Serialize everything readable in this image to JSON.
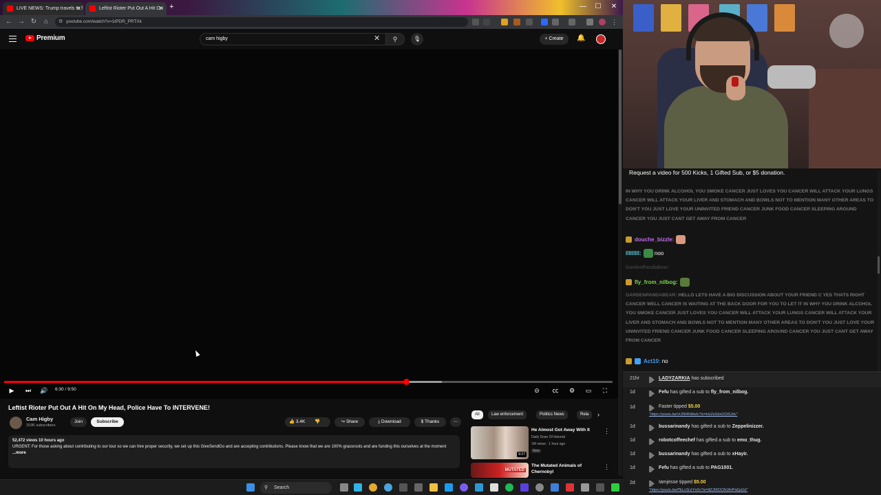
{
  "browser": {
    "tabs": [
      {
        "title": "LIVE NEWS: Trump travels to f",
        "active": false
      },
      {
        "title": "Leftist Rioter Put Out A Hit On",
        "active": true
      }
    ],
    "url": "youtube.com/watch?v=1tPDR_PRTXk",
    "window_controls": {
      "minimize": "—",
      "maximize": "☐",
      "close": "✕"
    }
  },
  "youtube": {
    "brand": "Premium",
    "search_value": "cam higby",
    "create_label": "Create",
    "player": {
      "time": "6:30 / 9:50",
      "progress": 0.661,
      "buffered": 0.72
    },
    "video": {
      "title": "Leftist Rioter Put Out A Hit On My Head, Police Have To INTERVENE!",
      "channel": "Cam Higby",
      "subscribers": "153K subscribers",
      "join_label": "Join",
      "subscribe_label": "Subscribe",
      "likes": "3.4K",
      "share_label": "Share",
      "download_label": "Download",
      "thanks_label": "Thanks",
      "more_label": "⋯"
    },
    "description": {
      "meta": "52,472 views  10 hours ago",
      "text": "URGENT: For those asking about contributing to our tour so we can hire proper security, we set up this GiveSendGo and are accepting contributions. Please know that we are 100% grassroots and are funding this ourselves at the moment",
      "more": "...more"
    },
    "chips": [
      "All",
      "Law enforcement",
      "Politics News",
      "Rela"
    ],
    "recommended": [
      {
        "title": "He Almost Got Away With It",
        "channel": "Daily Dose Of Internet",
        "views": "1M views · 1 hour ago",
        "badge": "New",
        "duration": "8:27"
      },
      {
        "title": "The Mutated Animals of",
        "title2": "Chernobyl",
        "label": "MUTATED"
      }
    ]
  },
  "taskbar": {
    "search_label": "Search"
  },
  "chat": {
    "banner": "Request a video for 500 Kicks, 1 Gifted Sub, or $5 donation.",
    "messages": [
      {
        "user": "",
        "text": "IN WHY YOU DRINK ALCOHOL YOU SMOKE CANCER JUST LOVES YOU CANCER WILL ATTACK YOUR LUNGS CANCER WILL ATTACK YOUR LIVER AND STOMACH AND BOWLS NOT TO MENTION MANY OTHER AREAS TO DON'T YOU JUST LOVE YOUR UNINVITED FRIEND CANCER JUNK FOOD CANCER SLEEPING AROUND CANCER YOU JUST CANT GET AWAY FROM CANCER"
      },
      {
        "user": "douche_bizzle:",
        "text": "",
        "color": "#c26bf0"
      },
      {
        "user": "lllllllll:",
        "text": "noo",
        "color": "#56c8d8"
      },
      {
        "user": "GardenPandaBear:",
        "text": "",
        "ghost": true
      },
      {
        "user": "fly_from_nilbog:",
        "text": "",
        "color": "#7dd64f"
      },
      {
        "user": "GardenPandaBear:",
        "text": "HELLO LETS HAVE A BIG DISCUSSION ABOUT YOUR FRIEND C YES THATS RIGHT CANCER WELL CANCER IS WAITING AT THE BACK DOOR FOR YOU TO LET IT IN WHY YOU DRINK ALCOHOL YOU SMOKE CANCER JUST LOVES YOU CANCER WILL ATTACK YOUR LUNGS CANCER WILL ATTACK YOUR LIVER AND STOMACH AND BOWLS NOT TO MENTION MANY OTHER AREAS TO DON'T YOU JUST LOVE YOUR UNINVITED FRIEND CANCER JUNK FOOD CANCER SLEEPING AROUND CANCER YOU JUST CANT GET AWAY FROM CANCER"
      },
      {
        "user": "Act10:",
        "text": "no",
        "color": "#3fa3f5"
      }
    ]
  },
  "alerts": [
    {
      "time": "21hr",
      "pre": "",
      "user": "LADYZARKIA",
      "text": " has subscribed"
    },
    {
      "time": "1d",
      "pre": "Fefu",
      "text": " has gifted a sub to ",
      "user": "fly_from_nilbog."
    },
    {
      "time": "1d",
      "pre": "Faster",
      "text": " tipped ",
      "amount": "$5.00",
      "link": "\"https://youtu.be/vU0lI4hMwtc?si=Hx2oSbxOOi5Jrlv\""
    },
    {
      "time": "1d",
      "pre": "bussarinandy",
      "text": " has gifted a sub to ",
      "user": "Zeppelinizzer."
    },
    {
      "time": "1d",
      "pre": "robotcoffeechef",
      "text": " has gifted a sub to ",
      "user": "emo_thug."
    },
    {
      "time": "1d",
      "pre": "bussarinandy",
      "text": " has gifted a sub to ",
      "user": "xHayir."
    },
    {
      "time": "1d",
      "pre": "Fefu",
      "text": " has gifted a sub to ",
      "user": "PAG1001."
    },
    {
      "time": "2d",
      "pre": "Iamjesse",
      "text": " tipped ",
      "amount": "$5.00",
      "link": "\"https://youtu.be/PkLzSLkYn0c?si=8ZJWOONJtHPsEpGd\""
    }
  ]
}
